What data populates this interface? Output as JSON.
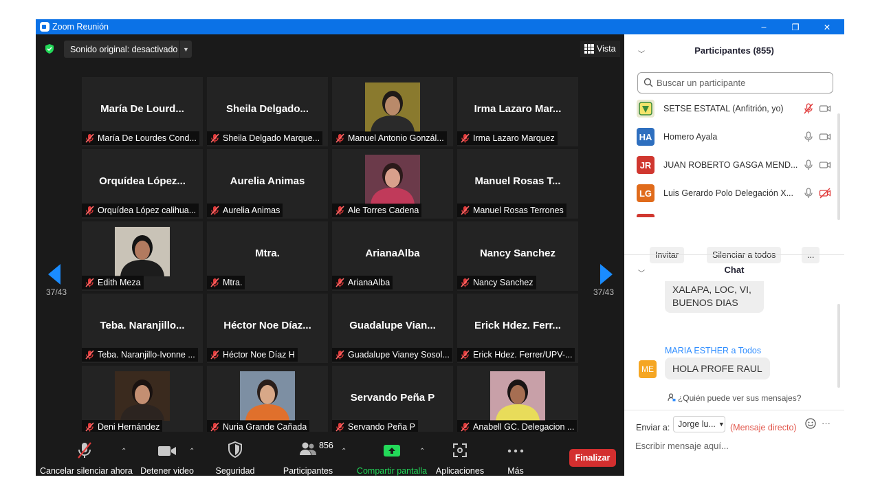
{
  "window": {
    "title": "Zoom Reunión",
    "minimize_glyph": "–",
    "restore_glyph": "❐",
    "close_glyph": "✕"
  },
  "topbar": {
    "sound_label": "Sonido original: desactivado",
    "view_label": "Vista"
  },
  "pagination": {
    "left": "37/43",
    "right": "37/43"
  },
  "tiles": [
    {
      "name": "María De Lourd...",
      "label": "María De Lourdes Cond...",
      "photo": null
    },
    {
      "name": "Sheila  Delgado...",
      "label": "Sheila Delgado Marque...",
      "photo": null
    },
    {
      "name": "",
      "label": "Manuel Antonio Gonzál...",
      "photo": {
        "bg": "#8a7a2e",
        "skin": "#b98a6a",
        "hair": "#1f1a17",
        "body": "#2a2a2a"
      }
    },
    {
      "name": "Irma Lazaro Mar...",
      "label": "Irma Lazaro Marquez",
      "photo": null
    },
    {
      "name": "Orquídea  López...",
      "label": "Orquídea López calihua...",
      "photo": null
    },
    {
      "name": "Aurelia Animas",
      "label": "Aurelia Animas",
      "photo": null
    },
    {
      "name": "",
      "label": "Ale Torres Cadena",
      "photo": {
        "bg": "#6b3a4a",
        "skin": "#d9a08c",
        "hair": "#2b1a1a",
        "body": "#c03a5a"
      }
    },
    {
      "name": "Manuel Rosas T...",
      "label": "Manuel Rosas Terrones",
      "photo": null
    },
    {
      "name": "",
      "label": "Edith Meza",
      "photo": {
        "bg": "#c9c3b7",
        "skin": "#b27a5f",
        "hair": "#141414",
        "body": "#1c1c1c"
      }
    },
    {
      "name": "Mtra.",
      "label": "Mtra.",
      "photo": null
    },
    {
      "name": "ArianaAlba",
      "label": "ArianaAlba",
      "photo": null
    },
    {
      "name": "Nancy Sanchez",
      "label": "Nancy Sanchez",
      "photo": null
    },
    {
      "name": "Teba.  Naranjillo...",
      "label": "Teba. Naranjillo-Ivonne ...",
      "photo": null
    },
    {
      "name": "Héctor  Noe  Díaz...",
      "label": "Héctor Noe Díaz H",
      "photo": null
    },
    {
      "name": "Guadalupe  Vian...",
      "label": "Guadalupe Vianey Sosol...",
      "photo": null
    },
    {
      "name": "Erick  Hdez.  Ferr...",
      "label": "Erick Hdez. Ferrer/UPV-...",
      "photo": null
    },
    {
      "name": "",
      "label": "Deni Hernández",
      "photo": {
        "bg": "#3a2a1e",
        "skin": "#c48f72",
        "hair": "#1a1210",
        "body": "#2c2420"
      }
    },
    {
      "name": "",
      "label": "Nuria Grande Cañada",
      "photo": {
        "bg": "#7d8fa3",
        "skin": "#d8a888",
        "hair": "#2a1e1a",
        "body": "#e0702c"
      }
    },
    {
      "name": "Servando Peña P",
      "label": "Servando Peña P",
      "photo": null
    },
    {
      "name": "",
      "label": "Anabell GC. Delegacion ...",
      "photo": {
        "bg": "#c8a0a8",
        "skin": "#a66e52",
        "hair": "#1a1414",
        "body": "#e8dc5a"
      }
    }
  ],
  "toolbar": {
    "mute_label": "Cancelar silenciar ahora",
    "video_label": "Detener video",
    "security_label": "Seguridad",
    "participants_label": "Participantes",
    "participants_count": "856",
    "share_label": "Compartir pantalla",
    "apps_label": "Aplicaciones",
    "more_label": "Más",
    "end_label": "Finalizar",
    "caret": "⌃"
  },
  "colors": {
    "accent": "#0b72e7",
    "share_green": "#23d959",
    "end_red": "#d32f2f"
  },
  "participants_panel": {
    "title": "Participantes (855)",
    "search_placeholder": "Buscar un participante",
    "items": [
      {
        "initials": "",
        "avatar": "logo",
        "color": "#e9e9d0",
        "name": "SETSE ESTATAL (Anfitrión, yo)",
        "mic": "muted",
        "video": "on"
      },
      {
        "initials": "HA",
        "color": "#2e6fbf",
        "name": "Homero Ayala",
        "mic": "on",
        "video": "on"
      },
      {
        "initials": "JR",
        "color": "#d0372f",
        "name": "JUAN ROBERTO GASGA    MEND...",
        "mic": "on",
        "video": "on"
      },
      {
        "initials": "LG",
        "color": "#e06b1b",
        "name": "Luis Gerardo Polo Delegación X...",
        "mic": "on",
        "video": "off"
      }
    ],
    "invite_label": "Invitar",
    "mute_all_label": "Silenciar a todos",
    "more_label": "..."
  },
  "chat": {
    "title": "Chat",
    "prev_message_lines": [
      "XALAPA, LOC, VI,",
      "BUENOS DIAS"
    ],
    "sender_line": "MARIA ESTHER a Todos",
    "sender_initials": "ME",
    "message": "HOLA PROFE RAUL",
    "who_can_see": "¿Quién puede ver sus mensajes?",
    "send_to_label": "Enviar a:",
    "recipient": "Jorge lu...",
    "direct_label": "(Mensaje directo)",
    "more_label": "···",
    "compose_placeholder": "Escribir mensaje aquí..."
  }
}
